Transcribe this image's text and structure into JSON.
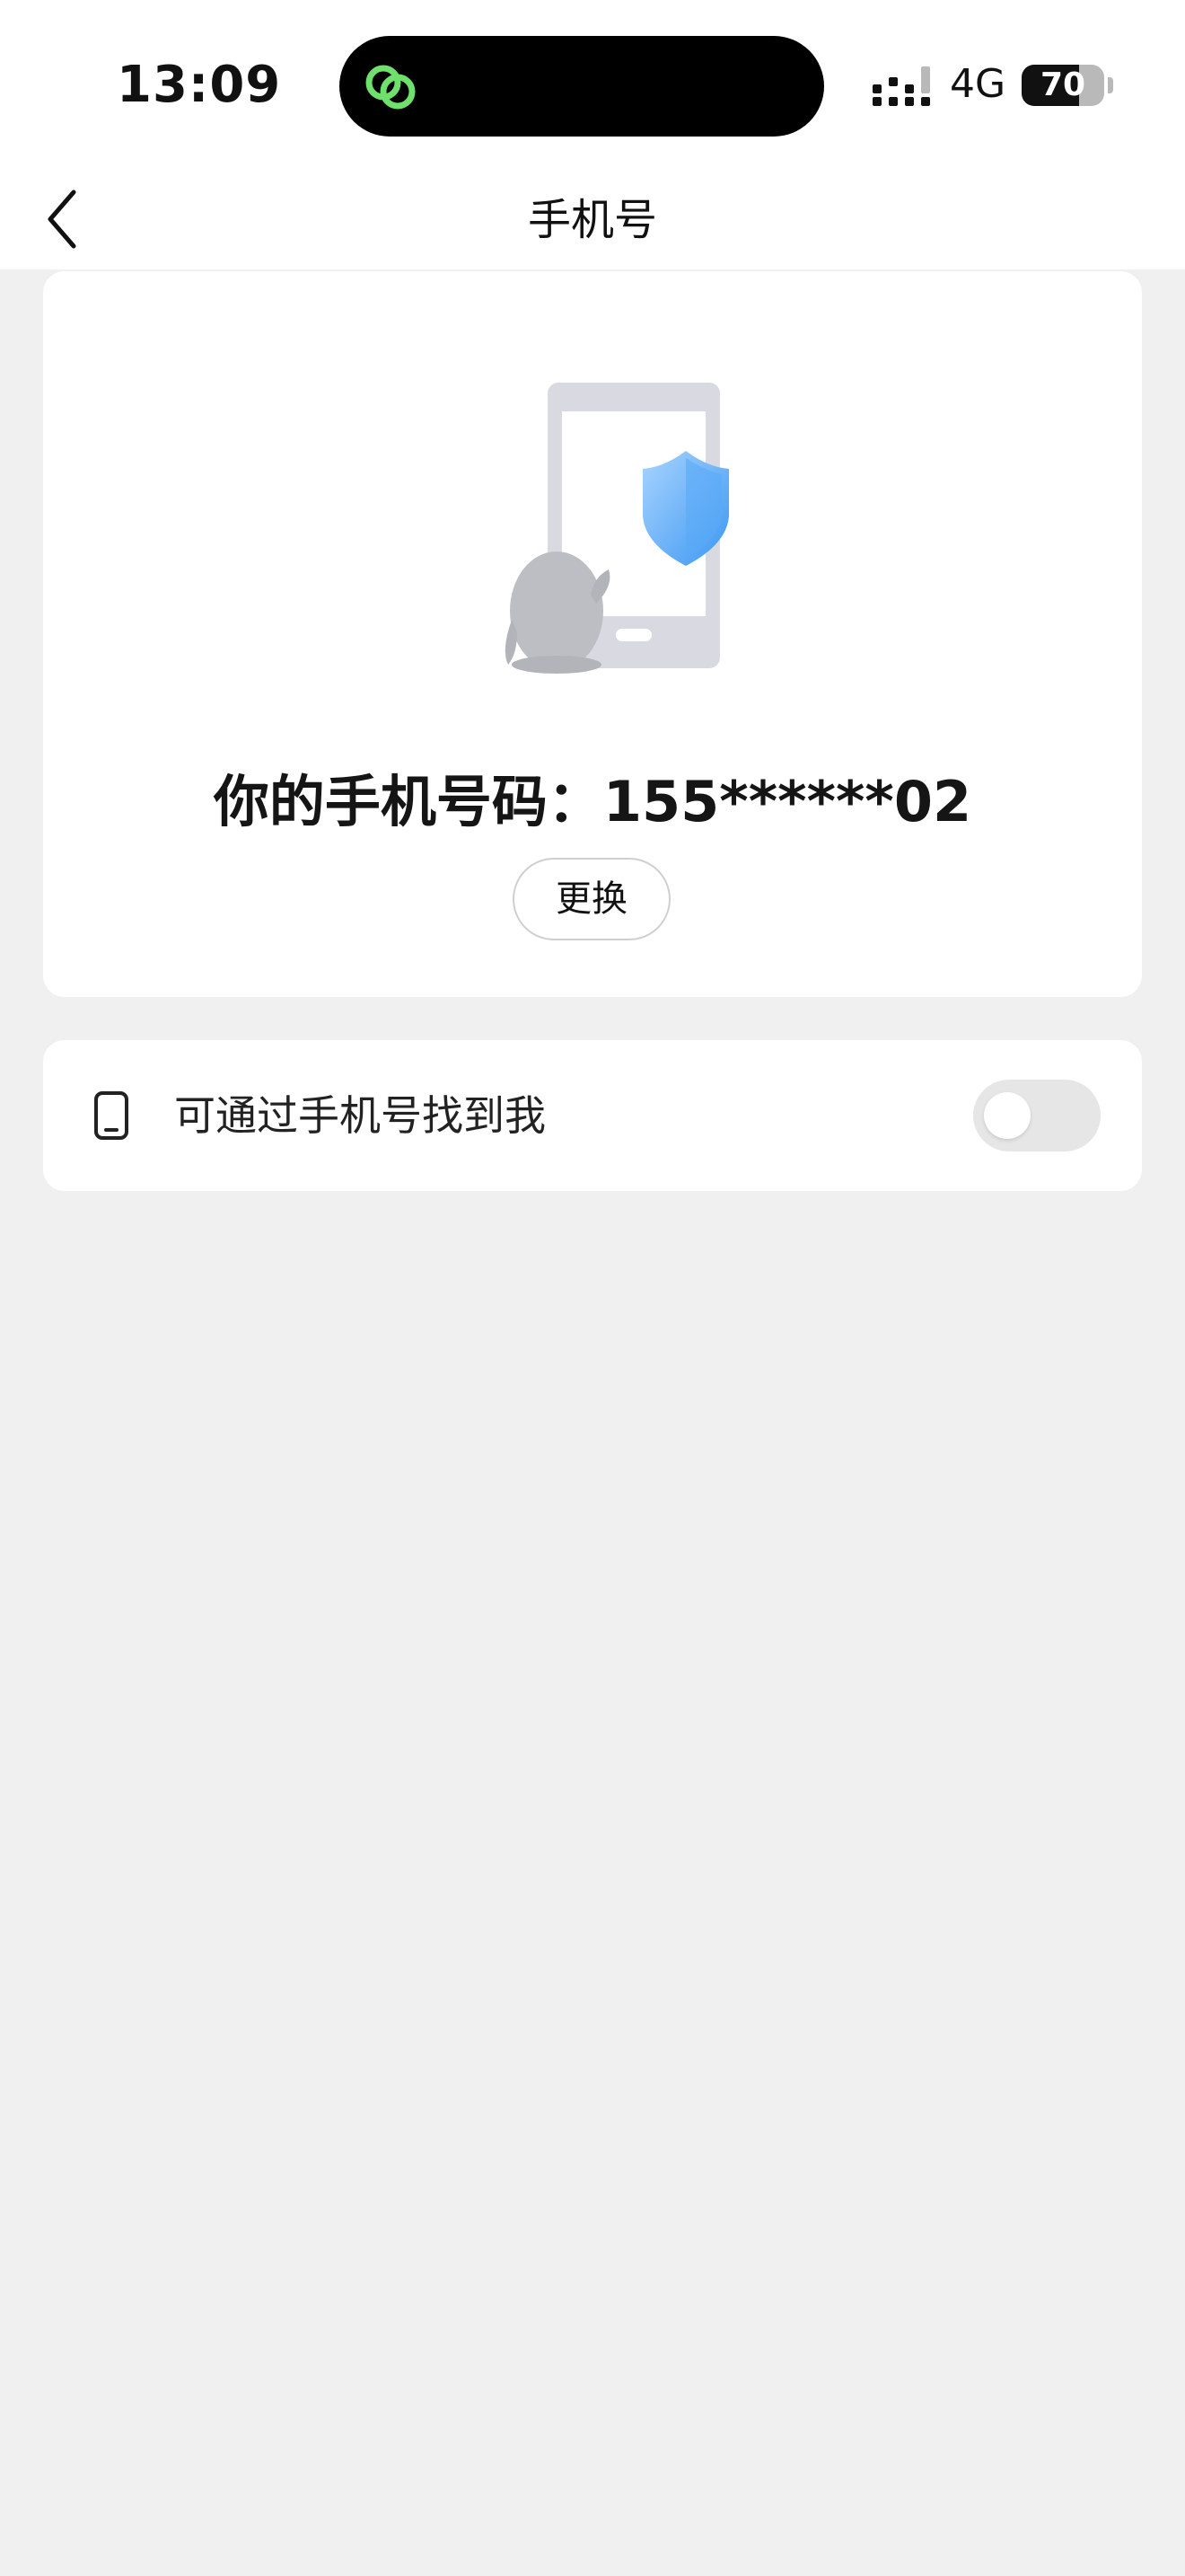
{
  "status_bar": {
    "time": "13:09",
    "network": "4G",
    "battery_level": 70,
    "battery_text": "70"
  },
  "nav": {
    "title": "手机号"
  },
  "phone_card": {
    "phone_label": "你的手机号码：155******02",
    "change_button_label": "更换"
  },
  "settings": {
    "find_by_phone_label": "可通过手机号找到我",
    "find_by_phone_enabled": false
  },
  "colors": {
    "background": "#f0f0f0",
    "card": "#ffffff",
    "shield_blue": "#4da6f8",
    "toggle_off": "#e6e6e6",
    "island_icon_green": "#6fe06c"
  },
  "icons": {
    "back": "chevron-left-icon",
    "island_app": "link-rings-icon",
    "illustration": "phone-shield-penguin-illustration",
    "setting": "smartphone-icon"
  }
}
